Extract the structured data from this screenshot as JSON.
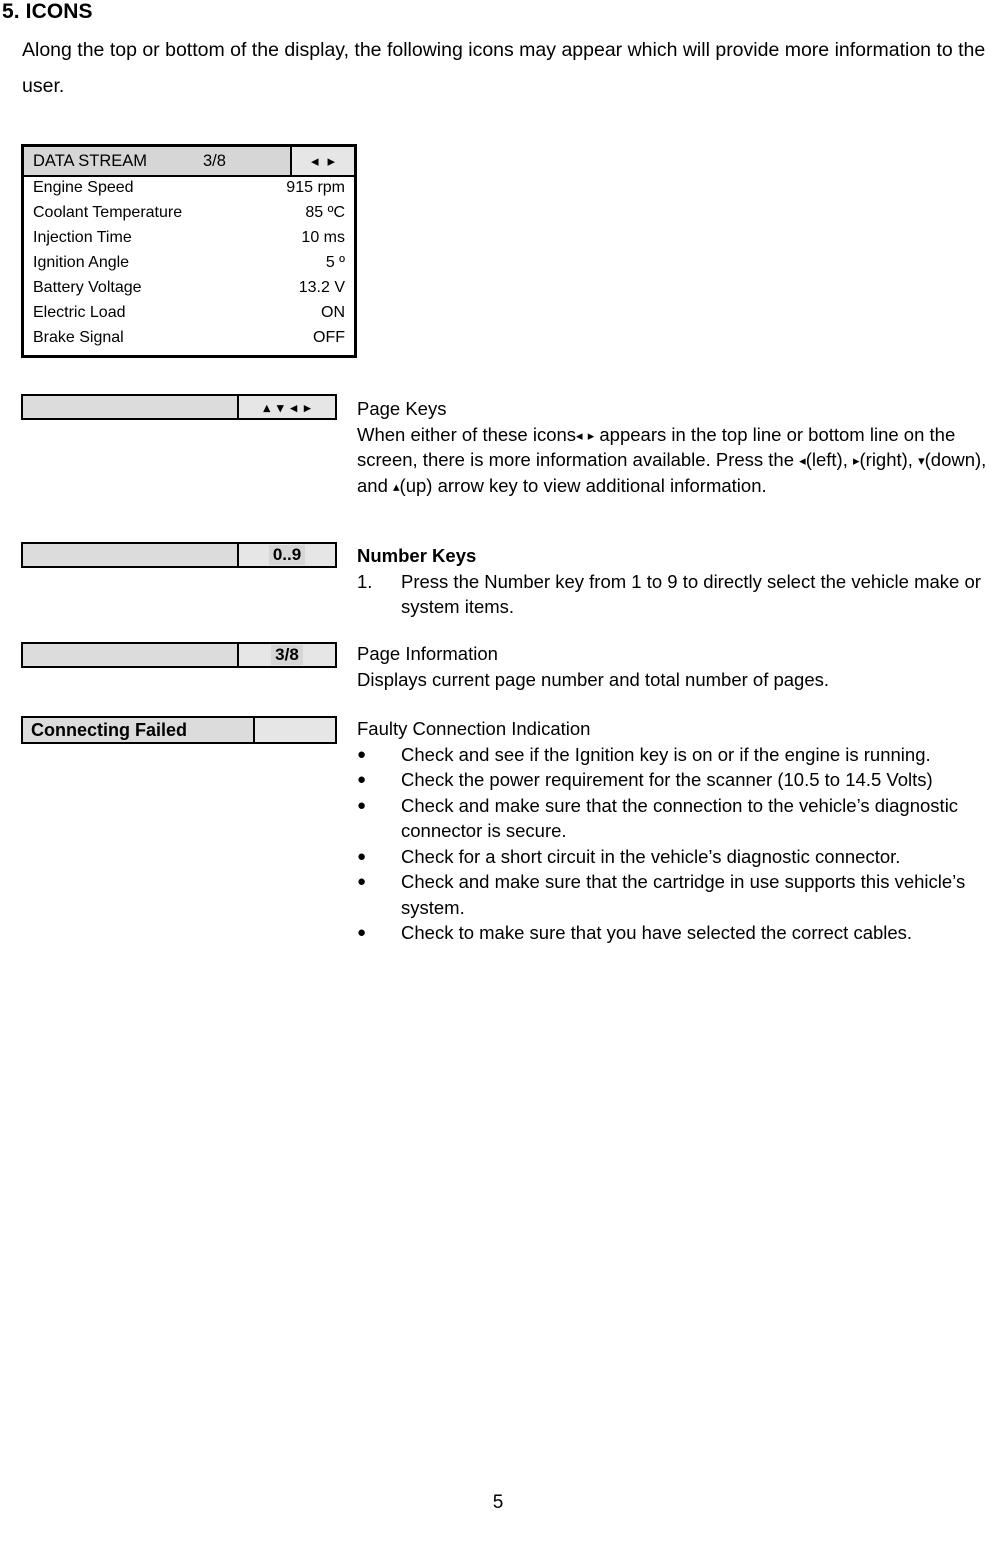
{
  "document": {
    "section_heading": "5. ICONS",
    "intro_paragraph": "Along the top or bottom of the display, the following icons may appear which will provide more information to the user.",
    "page_number": "5"
  },
  "lcd_panel": {
    "header": {
      "title": "DATA STREAM",
      "page_indicator": "3/8",
      "arrow_left": "◂",
      "arrow_right": "▸"
    },
    "rows": [
      {
        "label": "Engine Speed",
        "value": "915 rpm"
      },
      {
        "label": "Coolant Temperature",
        "value": "85 ºC"
      },
      {
        "label": "Injection Time",
        "value": "10 ms"
      },
      {
        "label": "Ignition Angle",
        "value": "5 º"
      },
      {
        "label": "Battery Voltage",
        "value": "13.2 V"
      },
      {
        "label": "Electric Load",
        "value": "ON"
      },
      {
        "label": "Brake Signal",
        "value": "OFF"
      }
    ]
  },
  "legend": {
    "page_keys": {
      "icon_box": {
        "left_cell": "",
        "arrow_up": "▴",
        "arrow_down": "▾",
        "arrow_left": "◂",
        "arrow_right": "▸"
      },
      "title": "Page Keys",
      "body_part1": "When either of these icons",
      "inline_left_1": "◂",
      "inline_right_1": "▸",
      "body_part2": "appears in the top line or bottom line on the screen, there is more information available. Press the",
      "inline_left_2": "◂",
      "body_part3": "(left),",
      "inline_right_2": "▸",
      "body_part4": "(right),",
      "inline_down": "▾",
      "body_part5": "(down), and",
      "inline_up": "▴",
      "body_part6": "(up) arrow key to view additional information."
    },
    "number_keys": {
      "icon_box": {
        "left_cell": "",
        "right_cell": "0..9"
      },
      "title": "Number Keys",
      "items": [
        {
          "number": "1.",
          "text": "Press the Number key from 1 to 9 to directly select the vehicle make or system items."
        }
      ]
    },
    "page_information": {
      "icon_box": {
        "left_cell": "",
        "right_cell": "3/8"
      },
      "title": "Page Information",
      "body": "Displays current page number and total number of pages."
    },
    "faulty_connection": {
      "icon_box": {
        "left_cell": "Connecting Failed",
        "right_cell": ""
      },
      "title": "Faulty Connection Indication",
      "bullet_char": "●",
      "bullets": [
        "Check and see if the Ignition key is on or if the engine is running.",
        "Check the power requirement for the scanner (10.5 to 14.5 Volts)",
        "Check and make sure that the connection to the vehicle’s diagnostic connector is secure.",
        "Check for a short circuit in the vehicle’s diagnostic connector.",
        "Check and make sure that the cartridge in use supports this vehicle’s system.",
        "Check to make sure that you have selected the correct cables."
      ]
    }
  },
  "colors": {
    "page_background": "#ffffff",
    "text": "#000000",
    "cell_dark_gray": "#dcdcdc",
    "cell_light_gray": "#e6e6e6",
    "lcd_header_gray": "#d6d6d6"
  }
}
